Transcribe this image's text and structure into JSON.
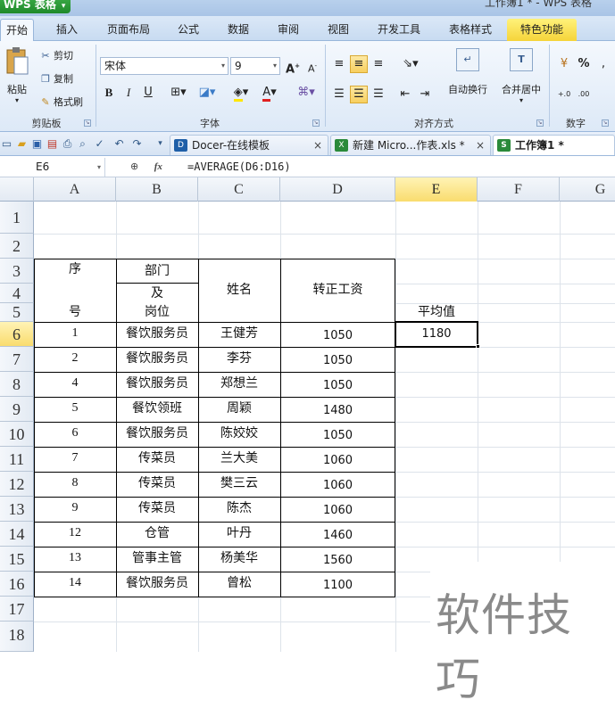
{
  "app": {
    "name": "WPS 表格",
    "window_title": "工作簿1 * - WPS 表格"
  },
  "ribbon_tabs": [
    {
      "label": "开始"
    },
    {
      "label": "插入"
    },
    {
      "label": "页面布局"
    },
    {
      "label": "公式"
    },
    {
      "label": "数据"
    },
    {
      "label": "审阅"
    },
    {
      "label": "视图"
    },
    {
      "label": "开发工具"
    },
    {
      "label": "表格样式"
    },
    {
      "label": "特色功能"
    }
  ],
  "ribbon": {
    "clipboard": {
      "paste": "粘贴",
      "cut": "剪切",
      "copy": "复制",
      "format_painter": "格式刷",
      "group": "剪贴板"
    },
    "font": {
      "name": "宋体",
      "size": "9",
      "group": "字体"
    },
    "align": {
      "wrap": "自动换行",
      "merge": "合并居中",
      "group": "对齐方式"
    },
    "number": {
      "group": "数字",
      "percent": "%"
    }
  },
  "doc_tabs": [
    {
      "label": "Docer-在线模板",
      "close": "×"
    },
    {
      "label": "新建 Micro...作表.xls *",
      "close": "×"
    },
    {
      "label": "工作簿1 *"
    }
  ],
  "formula_bar": {
    "cell_ref": "E6",
    "fx": "fx",
    "formula": "=AVERAGE(D6:D16)"
  },
  "columns": [
    "A",
    "B",
    "C",
    "D",
    "E",
    "F",
    "G"
  ],
  "rows": [
    "1",
    "2",
    "3",
    "4",
    "5",
    "6",
    "7",
    "8",
    "9",
    "10",
    "11",
    "12",
    "13",
    "14",
    "15",
    "16",
    "17",
    "18"
  ],
  "table": {
    "header_seq_top": "序",
    "header_seq_bottom": "号",
    "header_dept_top": "部门",
    "header_dept_mid": "及",
    "header_dept_bottom": "岗位",
    "header_name": "姓名",
    "header_salary": "转正工资",
    "rows": [
      {
        "seq": "1",
        "dept": "餐饮服务员",
        "name": "王健芳",
        "salary": "1050"
      },
      {
        "seq": "2",
        "dept": "餐饮服务员",
        "name": "李芬",
        "salary": "1050"
      },
      {
        "seq": "4",
        "dept": "餐饮服务员",
        "name": "郑想兰",
        "salary": "1050"
      },
      {
        "seq": "5",
        "dept": "餐饮领班",
        "name": "周颖",
        "salary": "1480"
      },
      {
        "seq": "6",
        "dept": "餐饮服务员",
        "name": "陈姣姣",
        "salary": "1050"
      },
      {
        "seq": "7",
        "dept": "传菜员",
        "name": "兰大美",
        "salary": "1060"
      },
      {
        "seq": "8",
        "dept": "传菜员",
        "name": "樊三云",
        "salary": "1060"
      },
      {
        "seq": "9",
        "dept": "传菜员",
        "name": "陈杰",
        "salary": "1060"
      },
      {
        "seq": "12",
        "dept": "仓管",
        "name": "叶丹",
        "salary": "1460"
      },
      {
        "seq": "13",
        "dept": "管事主管",
        "name": "杨美华",
        "salary": "1560"
      },
      {
        "seq": "14",
        "dept": "餐饮服务员",
        "name": "曾松",
        "salary": "1100"
      }
    ]
  },
  "average": {
    "label": "平均值",
    "value": "1180"
  },
  "watermark": "软件技巧",
  "colors": {
    "accent": "#f9dc6e",
    "app_green": "#2a9a35",
    "selection": "#000000"
  }
}
